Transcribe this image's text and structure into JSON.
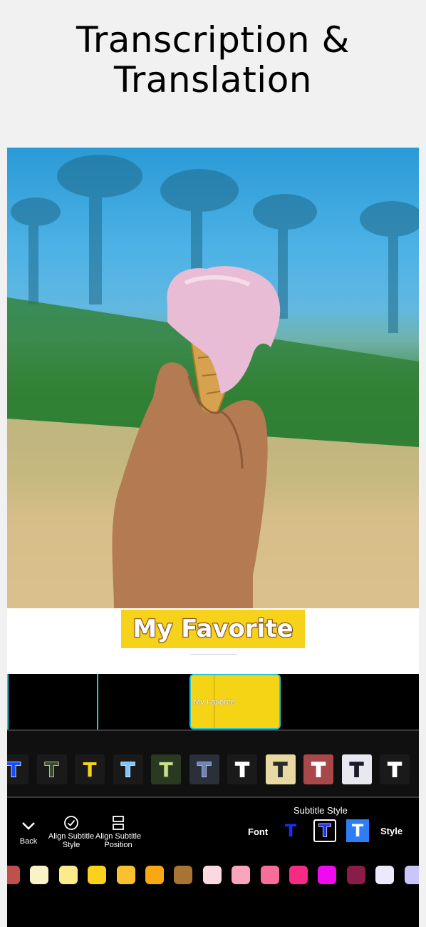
{
  "headline": {
    "line1": "Transcription &",
    "line2": "Translation"
  },
  "subtitle": {
    "text": "My Favorite"
  },
  "timeline": {
    "clip_label": "My Favorite"
  },
  "text_styles": [
    {
      "fg": "#1a4cff",
      "bg": "#1a1a1a",
      "stroke": "#ffffff"
    },
    {
      "fg": "#3a4a2a",
      "bg": "#1a1a1a",
      "stroke": "#d8e8c8"
    },
    {
      "fg": "#f6d21b",
      "bg": "#1a1a1a",
      "stroke": "#1a1a1a"
    },
    {
      "fg": "#7fc6ff",
      "bg": "#1a1a1a",
      "stroke": "#ffffff"
    },
    {
      "fg": "#c8e08a",
      "bg": "#2a3a22",
      "stroke": "#4a5a3a"
    },
    {
      "fg": "#6a86b6",
      "bg": "#2a2f3a",
      "stroke": "#c8d0e0"
    },
    {
      "fg": "#ffffff",
      "bg": "#1a1a1a",
      "stroke": "#ffffff"
    },
    {
      "fg": "#2a2a2a",
      "bg": "#e8d8a2",
      "stroke": "#2a2a2a"
    },
    {
      "fg": "#ffffff",
      "bg": "#a84848",
      "stroke": "#ffffff"
    },
    {
      "fg": "#1a1a2a",
      "bg": "#e8e8f0",
      "stroke": "#1a1a2a"
    },
    {
      "fg": "#ffffff",
      "bg": "#1a1a1a",
      "stroke": "#ffffff"
    }
  ],
  "tool_buttons": {
    "back": "Back",
    "align_style_l1": "Align Subtitle",
    "align_style_l2": "Style",
    "align_pos_l1": "Align Subtitle",
    "align_pos_l2": "Position"
  },
  "style_panel": {
    "title": "Subtitle Style",
    "font_label": "Font",
    "style_label": "Style",
    "options": [
      {
        "name": "blue-text",
        "letter": "T"
      },
      {
        "name": "outlined",
        "letter": "T",
        "selected": true
      },
      {
        "name": "filled-blue",
        "letter": "T"
      }
    ]
  },
  "colors": [
    "#c0504a",
    "#fbf3c8",
    "#fbeb8a",
    "#fbd21b",
    "#fbc030",
    "#fba712",
    "#a87433",
    "#fcd9e1",
    "#fba5bc",
    "#f96d9a",
    "#f72b84",
    "#ef0bef",
    "#8a1d48",
    "#ece9fb",
    "#c8c6fb"
  ]
}
